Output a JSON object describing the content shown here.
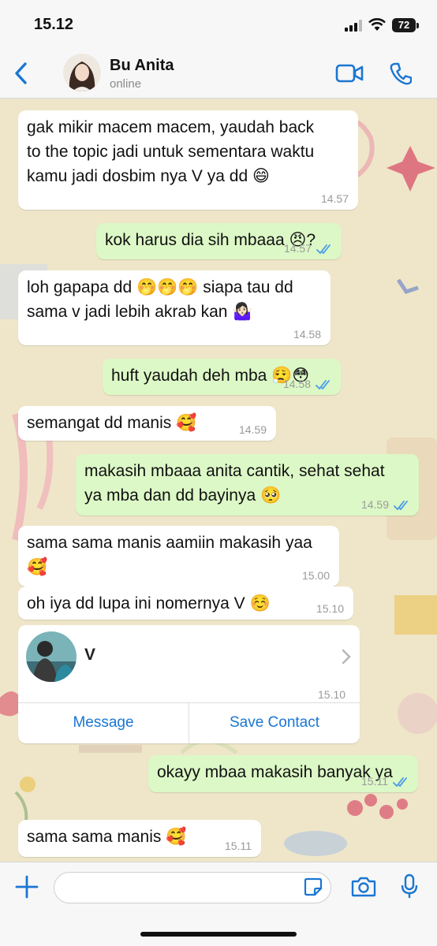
{
  "status_bar": {
    "time": "15.12",
    "battery": "72"
  },
  "header": {
    "contact_name": "Bu Anita",
    "contact_status": "online"
  },
  "messages": [
    {
      "dir": "in",
      "text": "gak mikir macem macem, yaudah back\nto the topic jadi untuk sementara waktu\nkamu jadi dosbim nya V ya dd 😄",
      "time": "14.57"
    },
    {
      "dir": "out",
      "text": "kok harus dia sih mbaaa 😠?",
      "time": "14.57"
    },
    {
      "dir": "in",
      "text": "loh gapapa dd 🤭🤭🤭 siapa tau dd\nsama v jadi lebih akrab kan 🤷🏻‍♀️",
      "time": "14.58"
    },
    {
      "dir": "out",
      "text": "huft yaudah deh mba 😮‍💨😳",
      "time": "14.58"
    },
    {
      "dir": "in",
      "text": "semangat dd manis 🥰",
      "time": "14.59"
    },
    {
      "dir": "out",
      "text": "makasih mbaaa anita cantik, sehat sehat\nya mba dan dd bayinya 🥺",
      "time": "14.59"
    },
    {
      "dir": "in",
      "text": "sama sama manis aamiin makasih yaa\n🥰",
      "time": "15.00"
    },
    {
      "dir": "in",
      "text": "oh iya dd lupa ini nomernya V ☺️",
      "time": "15.10"
    },
    {
      "dir": "out",
      "text": "okayy mbaa makasih banyak ya",
      "time": "15.11"
    },
    {
      "dir": "in",
      "text": "sama sama manis 🥰",
      "time": "15.11"
    }
  ],
  "contact_card": {
    "name": "V",
    "time": "15.10",
    "message_btn": "Message",
    "save_btn": "Save Contact"
  },
  "colors": {
    "accent": "#1a76d2",
    "outgoing": "#dcf8c6",
    "incoming": "#ffffff",
    "read_ticks": "#4a9be8"
  },
  "icons": [
    "back-chevron-icon",
    "video-call-icon",
    "phone-call-icon",
    "plus-icon",
    "sticker-icon",
    "camera-icon",
    "mic-icon",
    "read-receipt-icon",
    "chevron-right-icon"
  ]
}
